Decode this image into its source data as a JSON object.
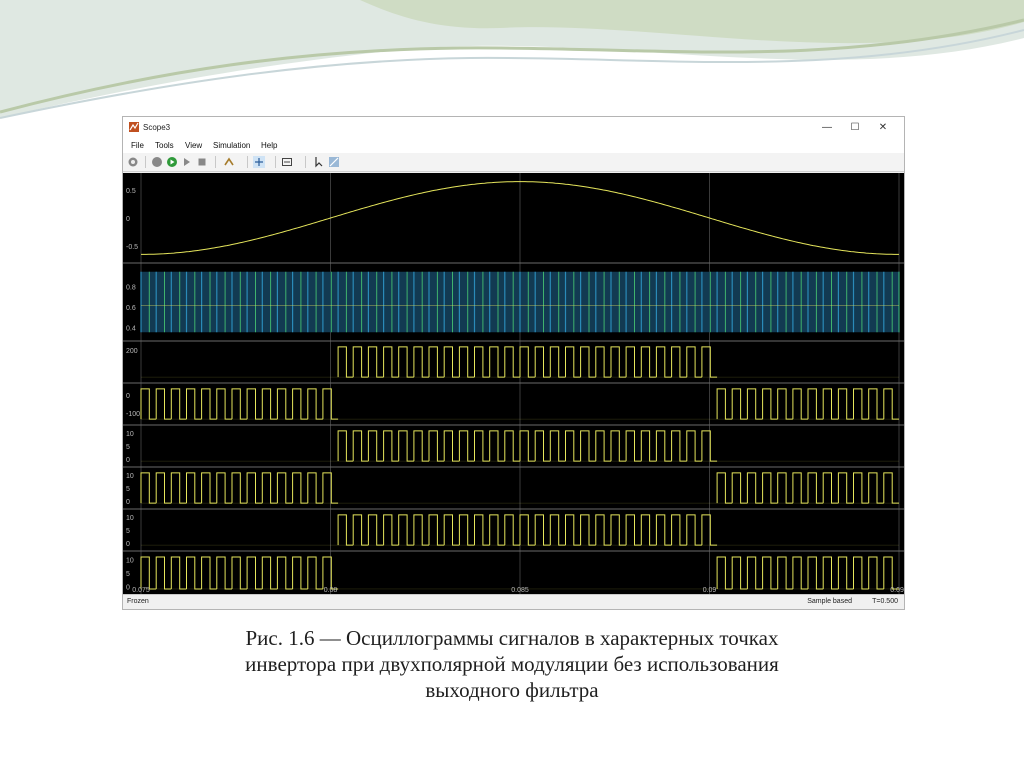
{
  "window": {
    "title": "Scope3",
    "controls": {
      "minimize": "—",
      "maximize": "☐",
      "close": "✕"
    }
  },
  "menu": [
    "File",
    "Tools",
    "View",
    "Simulation",
    "Help"
  ],
  "toolbar_icons": [
    "settings-icon",
    "play-icon",
    "run-icon",
    "step-forward-icon",
    "stop-icon",
    "highlight-icon",
    "zoom-icon",
    "fit-icon",
    "cursor-icon",
    "style-icon"
  ],
  "status": {
    "left": "Frozen",
    "mode": "Sample based",
    "time": "T=0.500"
  },
  "colors": {
    "plot_background": "#000000",
    "trace_yellow": "#e6e65c",
    "trace_blue": "#2a8ab8",
    "trace_green": "#3fb26d"
  },
  "chart_data": {
    "type": "line",
    "x_ticks": [
      "0.075",
      "0.08",
      "0.085",
      "0.09",
      "0.095"
    ],
    "xlim": [
      0.075,
      0.095
    ],
    "panels": [
      {
        "name": "reference-sine",
        "ticks": [
          "0.5",
          "0",
          "-0.5"
        ],
        "ylim": [
          -0.75,
          0.75
        ],
        "series": [
          {
            "kind": "sine",
            "period": 0.02,
            "phase_peak_x": 0.085,
            "amplitude": 0.65
          }
        ]
      },
      {
        "name": "carrier-pwm",
        "ticks": [
          "0.8",
          "0.6",
          "0.4"
        ],
        "ylim": [
          0.3,
          1.0
        ],
        "series": [
          {
            "kind": "pwm-both"
          }
        ]
      },
      {
        "name": "output-1",
        "ticks": [
          "200"
        ],
        "ylim": [
          -50,
          250
        ],
        "series": [
          {
            "kind": "pwm-active",
            "active": [
              0.08,
              0.09
            ]
          }
        ]
      },
      {
        "name": "output-2",
        "ticks": [
          "0",
          "-100"
        ],
        "ylim": [
          -150,
          50
        ],
        "series": [
          {
            "kind": "pwm-active",
            "active": [
              [
                0.075,
                0.08
              ],
              [
                0.09,
                0.095
              ]
            ]
          }
        ]
      },
      {
        "name": "output-3",
        "ticks": [
          "10",
          "5",
          "0"
        ],
        "ylim": [
          -2,
          12
        ],
        "series": [
          {
            "kind": "pwm-active",
            "active": [
              0.08,
              0.09
            ]
          }
        ]
      },
      {
        "name": "output-4",
        "ticks": [
          "10",
          "5",
          "0"
        ],
        "ylim": [
          -2,
          12
        ],
        "series": [
          {
            "kind": "pwm-active",
            "active": [
              [
                0.075,
                0.08
              ],
              [
                0.09,
                0.095
              ]
            ]
          }
        ]
      },
      {
        "name": "output-5",
        "ticks": [
          "10",
          "5",
          "0"
        ],
        "ylim": [
          -2,
          12
        ],
        "series": [
          {
            "kind": "pwm-active",
            "active": [
              0.08,
              0.09
            ]
          }
        ]
      },
      {
        "name": "output-6",
        "ticks": [
          "10",
          "5",
          "0"
        ],
        "ylim": [
          -2,
          12
        ],
        "series": [
          {
            "kind": "pwm-active",
            "active": [
              [
                0.075,
                0.08
              ],
              [
                0.09,
                0.095
              ]
            ]
          }
        ]
      }
    ]
  },
  "caption": {
    "line1": "Рис. 1.6 — Осциллограммы сигналов в характерных точках",
    "line2": "инвертора при двухполярной модуляции без использования",
    "line3": "выходного фильтра"
  }
}
